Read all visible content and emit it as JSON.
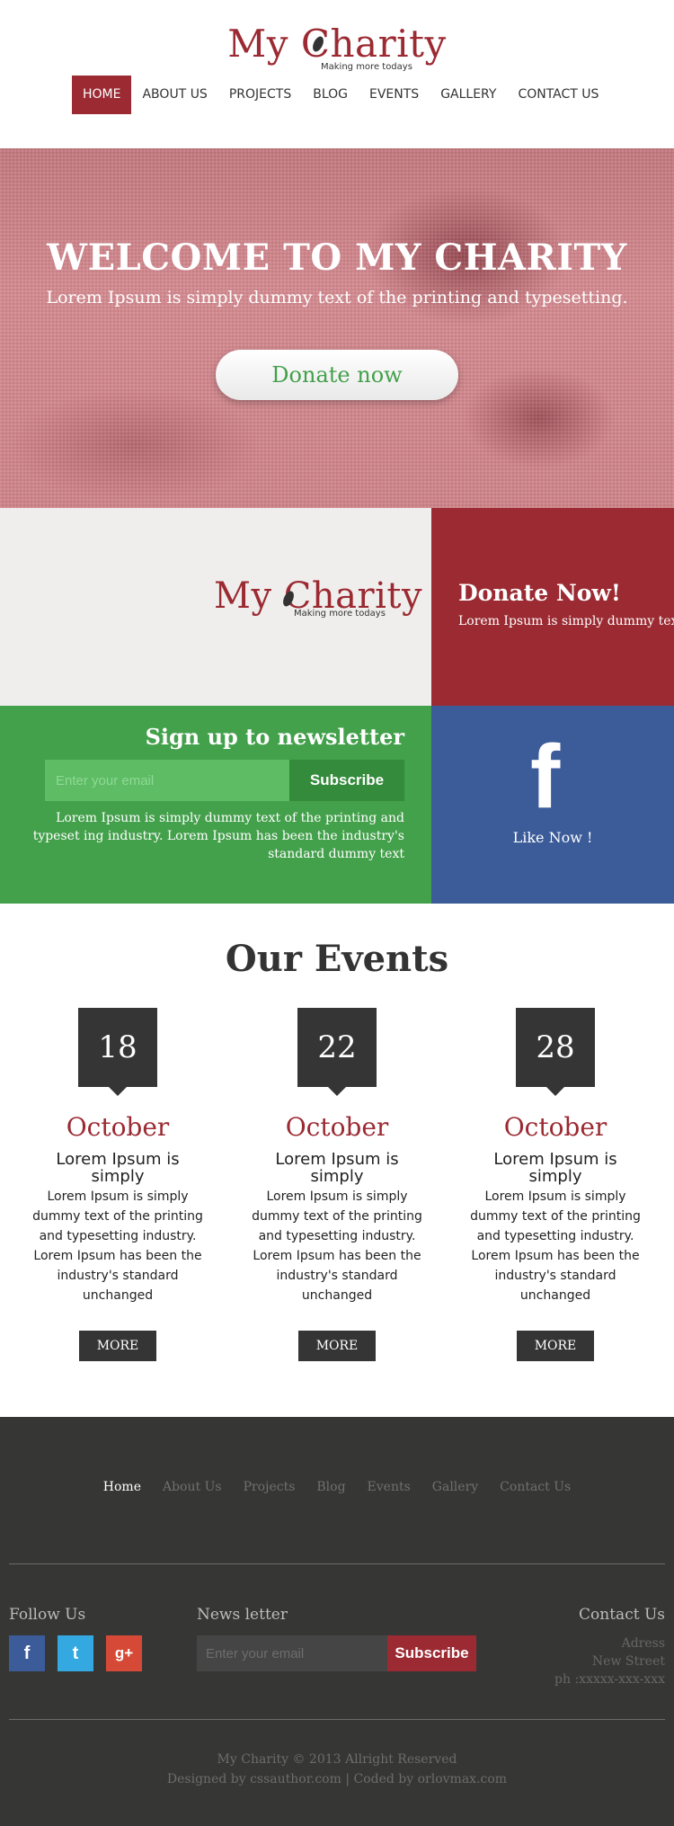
{
  "brand": {
    "name": "My Charity",
    "tagline": "Making more todays",
    "accent": "#9b2a32"
  },
  "nav": {
    "items": [
      {
        "label": "HOME",
        "active": true
      },
      {
        "label": "ABOUT US"
      },
      {
        "label": "PROJECTS"
      },
      {
        "label": "BLOG"
      },
      {
        "label": "EVENTS"
      },
      {
        "label": "GALLERY"
      },
      {
        "label": "CONTACT US"
      }
    ]
  },
  "hero": {
    "title": "WELCOME TO MY CHARITY",
    "subtitle": "Lorem Ipsum is simply dummy text of the printing and typesetting.",
    "cta": "Donate now"
  },
  "tiles": {
    "donate": {
      "title": "Donate Now!",
      "text": "Lorem Ipsum is simply dummy text."
    },
    "newsletter": {
      "title": "Sign up to newsletter",
      "placeholder": "Enter your email",
      "button": "Subscribe",
      "text": "Lorem Ipsum is simply dummy text of the printing and typeset ing industry. Lorem Ipsum has been the industry's standard dummy text"
    },
    "facebook": {
      "icon": "facebook-icon",
      "label": "Like Now !"
    }
  },
  "events": {
    "title": "Our Events",
    "items": [
      {
        "day": "18",
        "month": "October",
        "title": "Lorem Ipsum is simply",
        "text": "Lorem Ipsum is simply dummy text of the printing and typesetting industry. Lorem Ipsum has been the industry's standard unchanged",
        "button": "MORE"
      },
      {
        "day": "22",
        "month": "October",
        "title": "Lorem Ipsum is simply",
        "text": "Lorem Ipsum is simply dummy text of the printing and typesetting industry. Lorem Ipsum has been the industry's standard unchanged",
        "button": "MORE"
      },
      {
        "day": "28",
        "month": "October",
        "title": "Lorem Ipsum is simply",
        "text": "Lorem Ipsum is simply dummy text of the printing and typesetting industry. Lorem Ipsum has been the industry's standard unchanged",
        "button": "MORE"
      }
    ]
  },
  "footer": {
    "nav": [
      {
        "label": "Home",
        "active": true
      },
      {
        "label": "About Us"
      },
      {
        "label": "Projects"
      },
      {
        "label": "Blog"
      },
      {
        "label": "Events"
      },
      {
        "label": "Gallery"
      },
      {
        "label": "Contact Us"
      }
    ],
    "follow": {
      "label": "Follow Us",
      "icons": [
        {
          "name": "facebook-icon",
          "glyph": "f",
          "color": "#3b5b99"
        },
        {
          "name": "twitter-icon",
          "glyph": "t",
          "color": "#34a9e1"
        },
        {
          "name": "google-plus-icon",
          "glyph": "g+",
          "color": "#d64937"
        }
      ]
    },
    "newsletter": {
      "label": "News letter",
      "placeholder": "Enter your email",
      "button": "Subscribe"
    },
    "contact": {
      "label": "Contact Us",
      "lines": [
        "Adress",
        "New Street",
        "ph :xxxxx-xxx-xxx"
      ]
    },
    "copyright": "My Charity © 2013 Allright Reserved",
    "credits": "Designed by cssauthor.com | Coded by orlovmax.com"
  }
}
